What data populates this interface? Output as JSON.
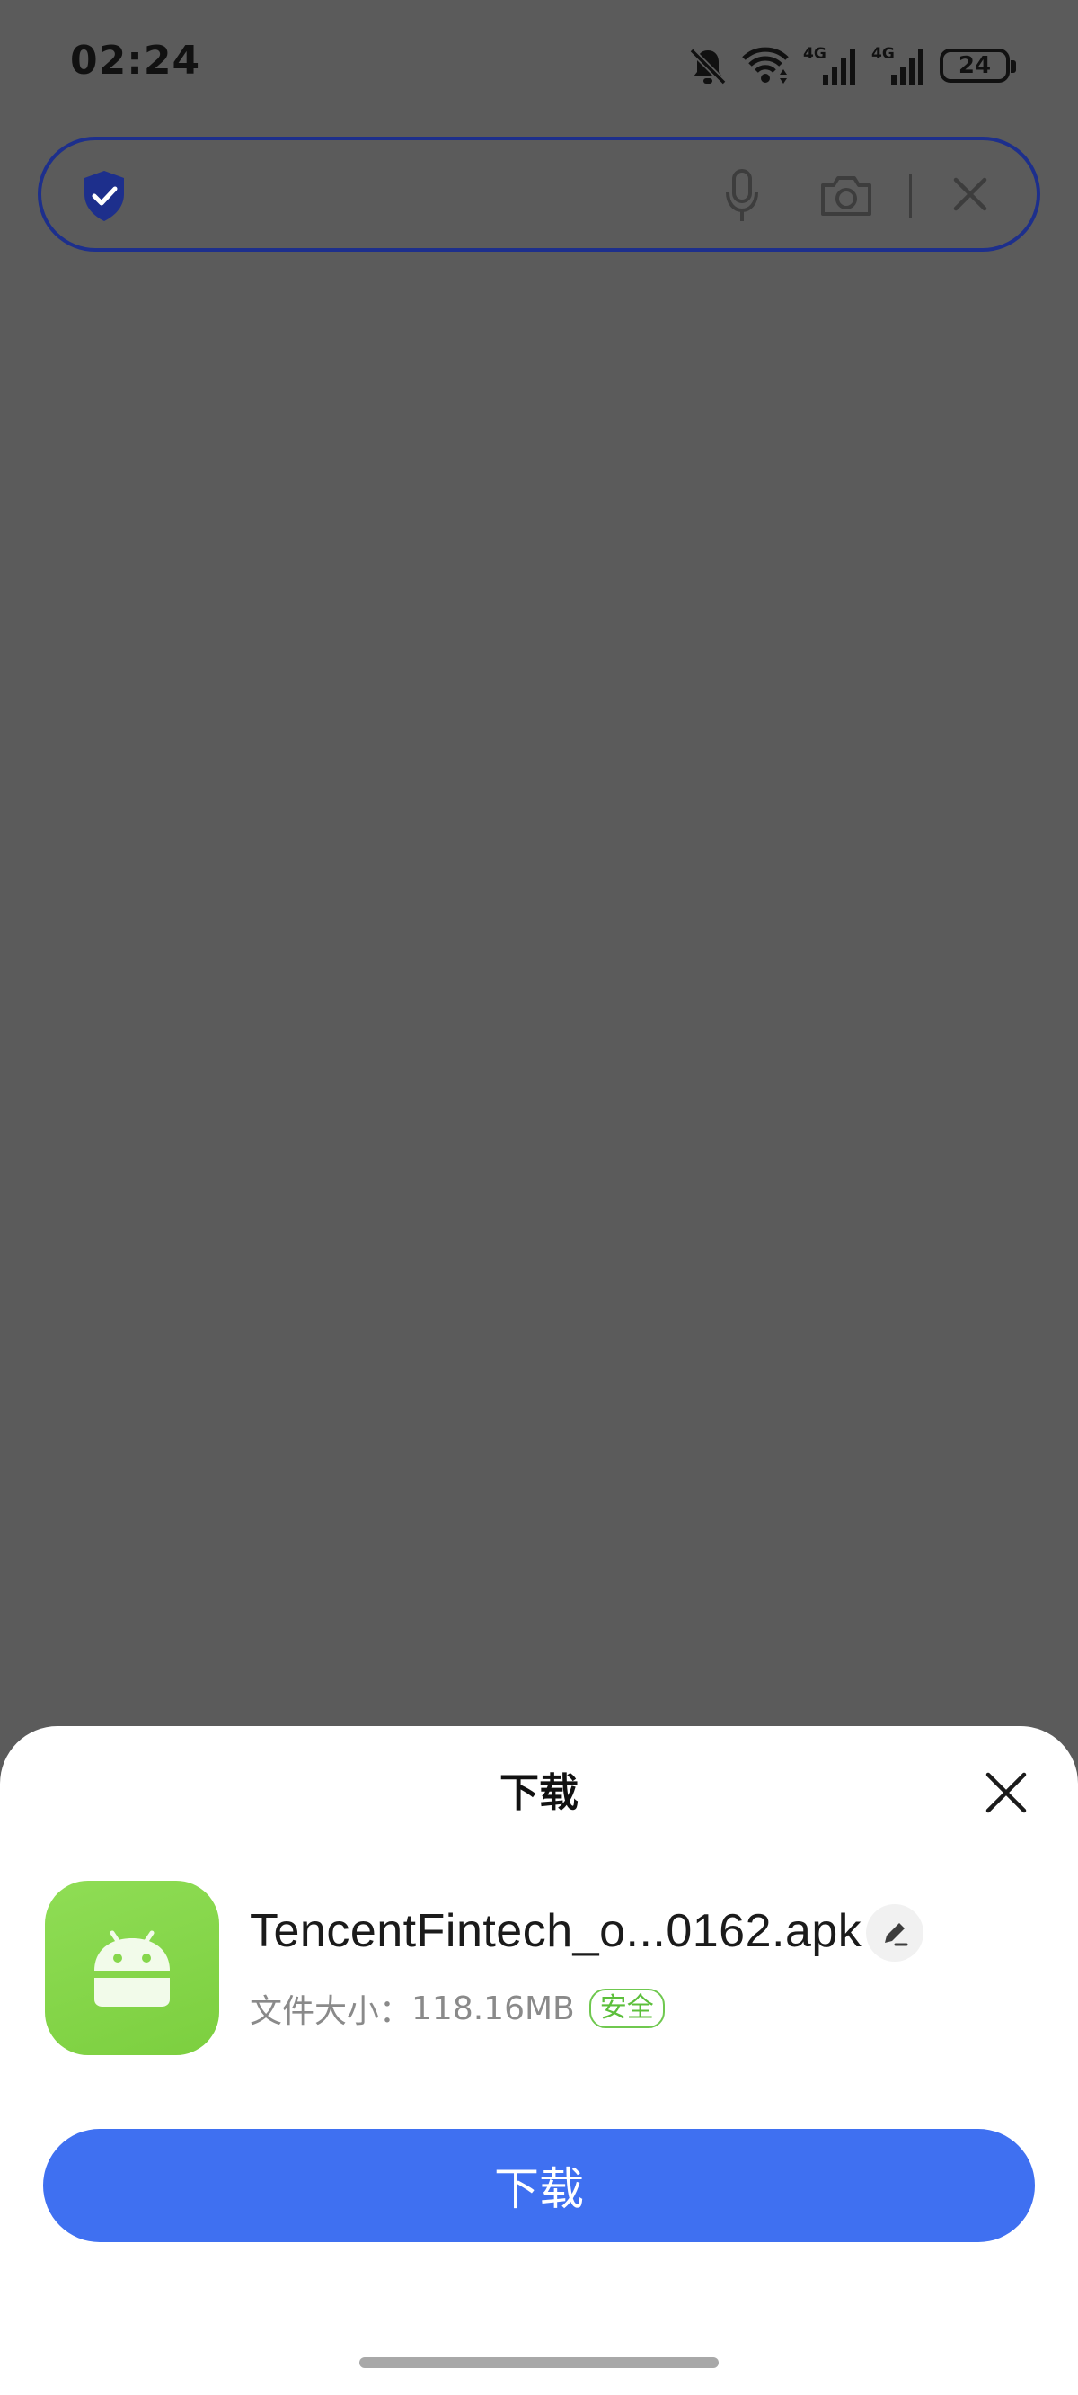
{
  "status_bar": {
    "time": "02:24",
    "battery": "24",
    "network_1": "4G",
    "network_2": "4G",
    "icons": [
      "bell-off-icon",
      "wifi-icon",
      "signal-4g-icon",
      "signal-4g-icon",
      "battery-icon"
    ]
  },
  "search_bar": {
    "value": "",
    "placeholder": "",
    "icons": [
      "shield-check-icon",
      "mic-icon",
      "camera-icon",
      "close-icon"
    ],
    "border_color": "#1d2f8c"
  },
  "download_sheet": {
    "title": "下载",
    "file_name": "TencentFintech_o...0162.apk",
    "file_size_label": "文件大小：",
    "file_size": "118.16MB",
    "safety_badge": "安全",
    "download_button": "下载",
    "app_icon": "android-icon",
    "accent_color": "#3f70f1",
    "badge_color": "#5cbf3b",
    "icon_color": "#86d74c"
  },
  "overlay_color": "#5b5b5b"
}
